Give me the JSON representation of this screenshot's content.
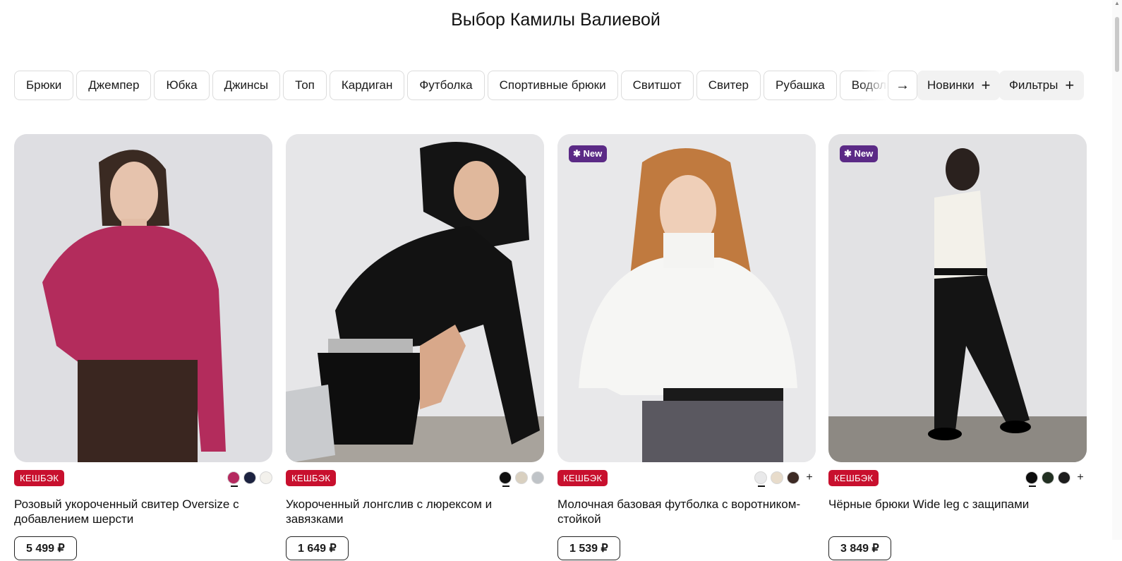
{
  "page": {
    "title": "Выбор Камилы Валиевой"
  },
  "categories": [
    "Брюки",
    "Джемпер",
    "Юбка",
    "Джинсы",
    "Топ",
    "Кардиган",
    "Футболка",
    "Спортивные брюки",
    "Свитшот",
    "Свитер",
    "Рубашка",
    "Водолазка"
  ],
  "controls": {
    "next_icon": "→",
    "new_label": "Новинки",
    "filters_label": "Фильтры",
    "plus": "+"
  },
  "colors": {
    "cashback": "#c8102e",
    "new_badge": "#5b2a86"
  },
  "products": [
    {
      "name": "Розовый укороченный свитер Oversize с добавлением шерсти",
      "price": "5 499 ₽",
      "cashback": "КЕШБЭК",
      "is_new": false,
      "swatches": [
        "#b5295f",
        "#1c2240",
        "#f3f1ec"
      ],
      "more": false
    },
    {
      "name": "Укороченный лонгслив с люрексом и завязками",
      "price": "1 649 ₽",
      "cashback": "КЕШБЭК",
      "is_new": false,
      "swatches": [
        "#111111",
        "#d9d0c0",
        "#bfc3c7"
      ],
      "more": false
    },
    {
      "name": "Молочная базовая футболка с воротником-стойкой",
      "price": "1 539 ₽",
      "cashback": "КЕШБЭК",
      "is_new": true,
      "new_label": "✱ New",
      "swatches": [
        "#e9e9ea",
        "#e8dccb",
        "#3d2a24"
      ],
      "more": true
    },
    {
      "name": "Чёрные брюки Wide leg с защипами",
      "price": "3 849 ₽",
      "cashback": "КЕШБЭК",
      "is_new": true,
      "new_label": "✱ New",
      "swatches": [
        "#0d0d0d",
        "#223022",
        "#1c1c1c"
      ],
      "more": true
    }
  ]
}
